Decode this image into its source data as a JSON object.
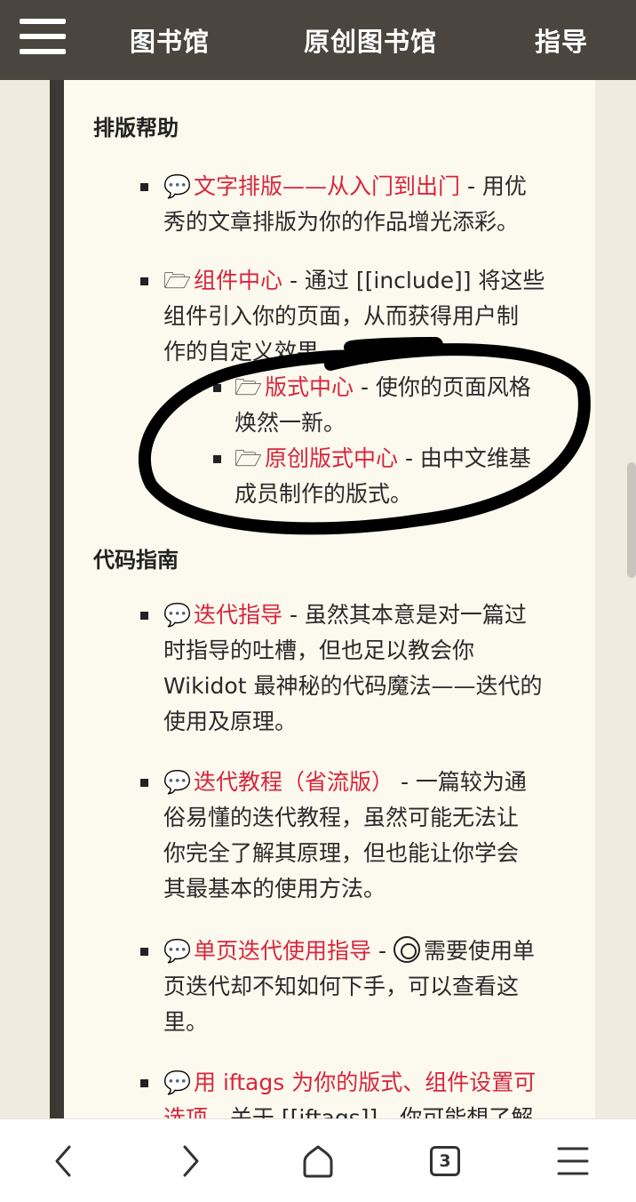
{
  "nav": {
    "items": [
      "图书馆",
      "原创图书馆",
      "指导"
    ]
  },
  "sections": {
    "layout_title": "排版帮助",
    "code_title": "代码指南"
  },
  "layout_items": [
    {
      "link": "文字排版——从入门到出门",
      "line1_rest": " - 用优",
      "line2": "秀的文章排版为你的作品增光添彩。"
    },
    {
      "link": "组件中心",
      "line1_rest": " - 通过 [[include]] 将这些",
      "line2": "组件引入你的页面，从而获得用户制",
      "line3": "作的自定义效果。"
    }
  ],
  "sub_items": [
    {
      "link": "版式中心",
      "line1_rest": " - 使你的页面风格",
      "line2": "焕然一新。"
    },
    {
      "link": "原创版式中心",
      "line1_rest": " - 由中文维基",
      "line2": "成员制作的版式。"
    }
  ],
  "code_items": [
    {
      "link": "迭代指导",
      "line1_rest": " - 虽然其本意是对一篇过",
      "line2": "时指导的吐槽，但也足以教会你",
      "line3": "Wikidot 最神秘的代码魔法——迭代的",
      "line4": "使用及原理。"
    },
    {
      "link": "迭代教程（省流版）",
      "line1_rest": " - 一篇较为通",
      "line2": "俗易懂的迭代教程，虽然可能无法让",
      "line3": "你完全了解其原理，但也能让你学会",
      "line4": "其最基本的使用方法。"
    },
    {
      "link": "单页迭代使用指导",
      "line1_rest": " - ",
      "line1_after": "需要使用单",
      "line2": "页迭代却不知如何下手，可以查看这",
      "line3": "里。"
    },
    {
      "link": "用 iftags 为你的版式、组件设置可",
      "line2_link": "选项",
      "line2_rest": " - 关于 [[iftags]]，你可能想了解"
    }
  ],
  "icons": {
    "speech": "speech-bubble-icon",
    "folder": "folder-icon"
  },
  "bottom": {
    "tab_count": "3"
  },
  "colors": {
    "link": "#d7263d",
    "topbar": "#4a463f",
    "content_bg": "#fcf9ee"
  }
}
